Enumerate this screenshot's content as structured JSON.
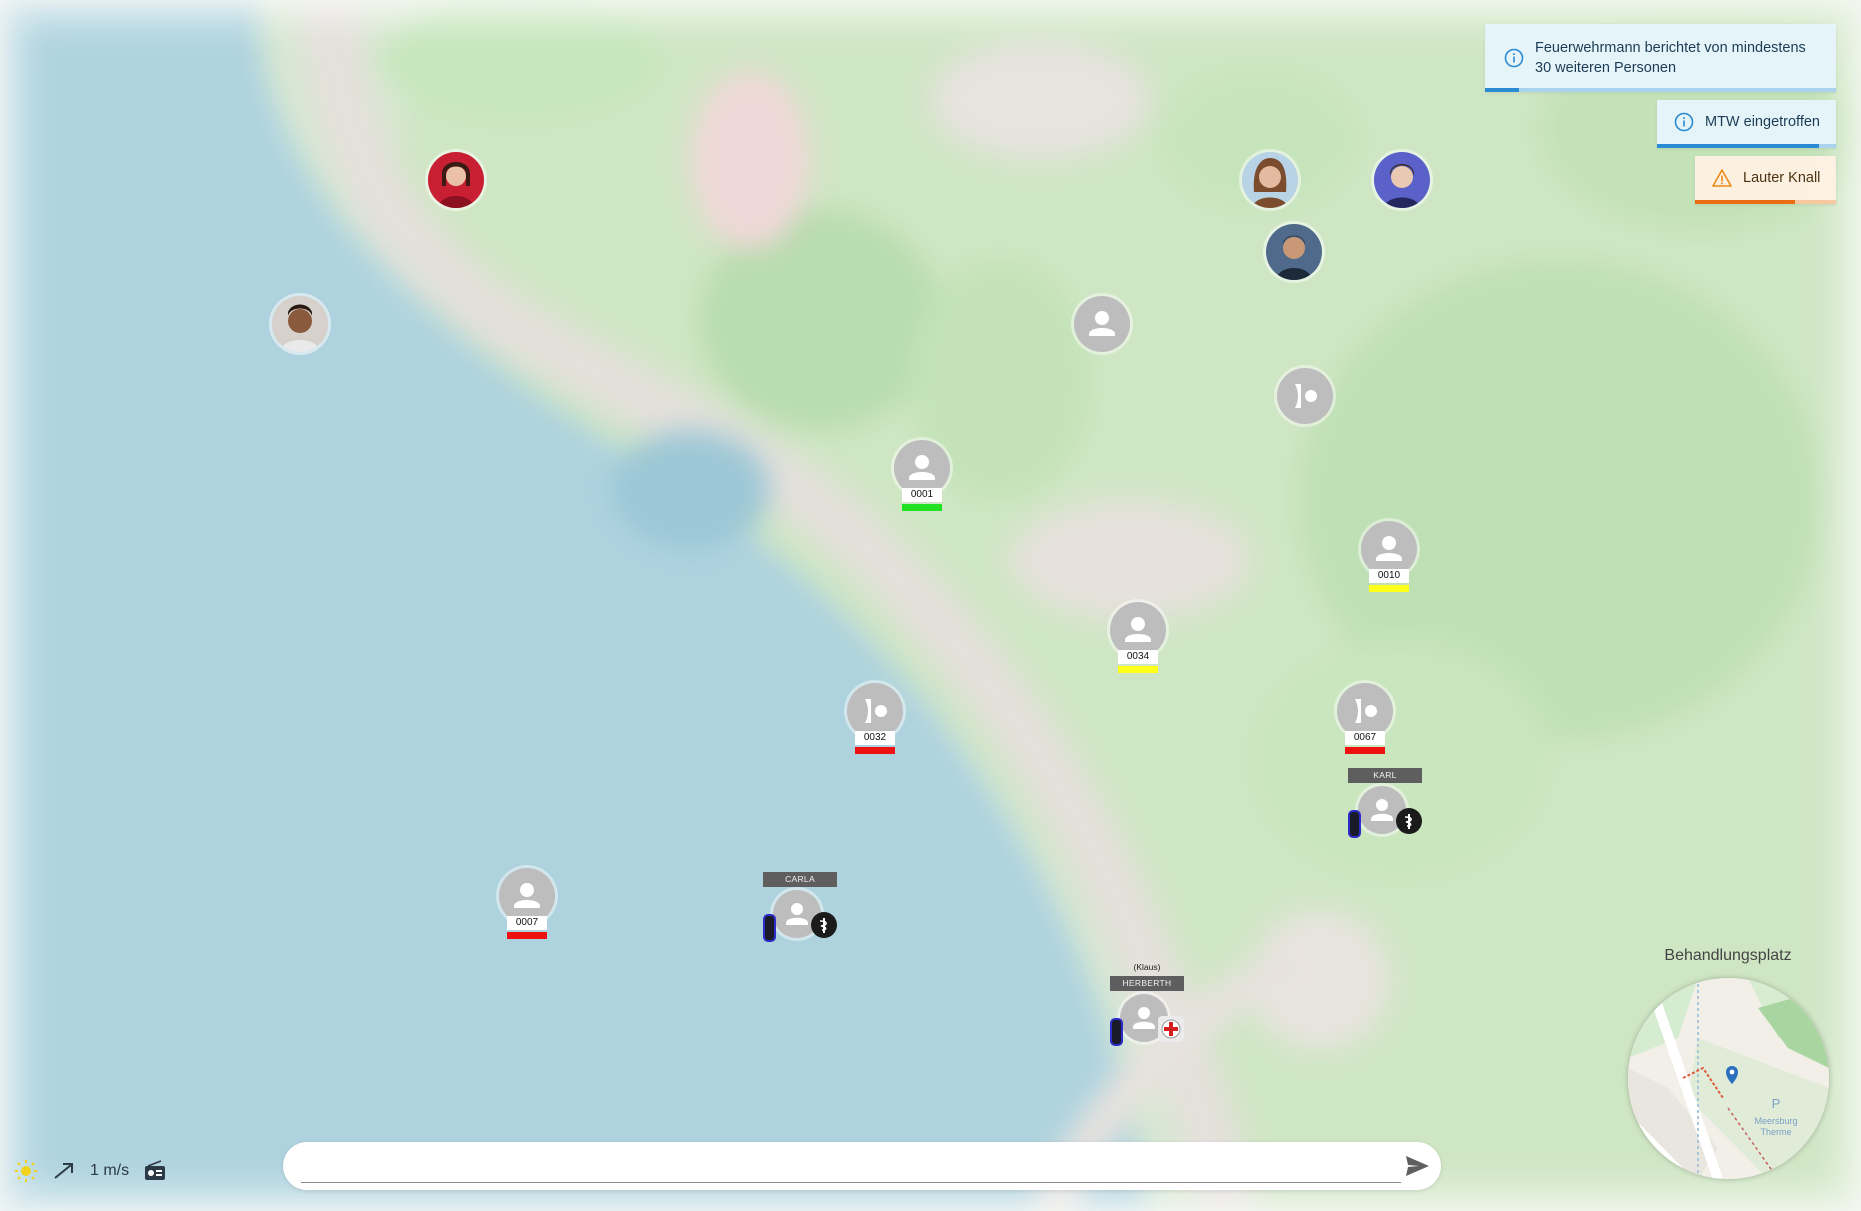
{
  "notifications": [
    {
      "type": "info",
      "text": "Feuerwehrmann berichtet von mindestens 30 weiteren Personen",
      "progress": 0.06
    },
    {
      "type": "info",
      "text": "MTW eingetroffen",
      "progress": 0.9
    },
    {
      "type": "warning",
      "text": "Lauter Knall",
      "progress": 0.7
    }
  ],
  "patients": [
    {
      "id": "0001",
      "triage": "green",
      "icon": "person-icon"
    },
    {
      "id": "0010",
      "triage": "yellow",
      "icon": "person-icon"
    },
    {
      "id": "0034",
      "triage": "yellow",
      "icon": "person-icon"
    },
    {
      "id": "0032",
      "triage": "red",
      "icon": "unconscious-icon"
    },
    {
      "id": "0067",
      "triage": "red",
      "icon": "unconscious-icon"
    },
    {
      "id": "0007",
      "triage": "red",
      "icon": "person-icon"
    }
  ],
  "responders": [
    {
      "name": "KARL",
      "badge": "medic-badge-icon"
    },
    {
      "name": "CARLA",
      "badge": "medic-badge-icon"
    },
    {
      "name": "HERBERTH",
      "sub": "(Klaus)",
      "badge": "red-cross-icon"
    }
  ],
  "triage_colors": {
    "green": "#22e022",
    "yellow": "#ffff1a",
    "red": "#ee1111"
  },
  "status": {
    "weather_icon": "sun-icon",
    "wind_icon": "wind-direction-icon",
    "wind_speed": "1 m/s",
    "radio_icon": "radio-icon"
  },
  "chat": {
    "placeholder": "",
    "send_icon": "send-icon"
  },
  "minimap": {
    "title": "Behandlungsplatz",
    "map_text_1": "P",
    "map_text_2": "Meersburg",
    "map_text_3": "Therme"
  }
}
